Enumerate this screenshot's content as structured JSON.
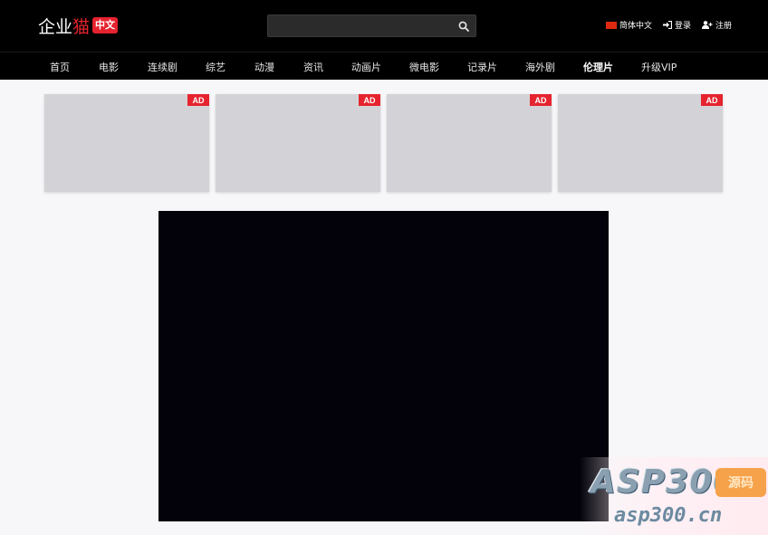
{
  "header": {
    "logo_main": "企业",
    "logo_accent": "猫",
    "logo_badge": "中文",
    "search": {
      "placeholder": "",
      "value": ""
    },
    "links": [
      {
        "label": "简体中文",
        "icon": "china-flag-icon"
      },
      {
        "label": "登录",
        "icon": "sign-in-icon"
      },
      {
        "label": "注册",
        "icon": "user-plus-icon"
      }
    ]
  },
  "nav": {
    "items": [
      {
        "label": "首页"
      },
      {
        "label": "电影"
      },
      {
        "label": "连续剧"
      },
      {
        "label": "综艺"
      },
      {
        "label": "动漫"
      },
      {
        "label": "资讯"
      },
      {
        "label": "动画片"
      },
      {
        "label": "微电影"
      },
      {
        "label": "记录片"
      },
      {
        "label": "海外剧"
      },
      {
        "label": "伦理片"
      },
      {
        "label": "升级VIP"
      }
    ],
    "active_index": 10
  },
  "ads": [
    {
      "badge": "AD"
    },
    {
      "badge": "AD"
    },
    {
      "badge": "AD"
    },
    {
      "badge": "AD"
    }
  ],
  "watermark": {
    "big": "ASP300",
    "tag": "源码",
    "small": "asp300.cn"
  },
  "colors": {
    "accent": "#e6232f",
    "header_bg": "#000000",
    "player_bg": "#03020a",
    "ad_bg": "#d3d3d7"
  }
}
